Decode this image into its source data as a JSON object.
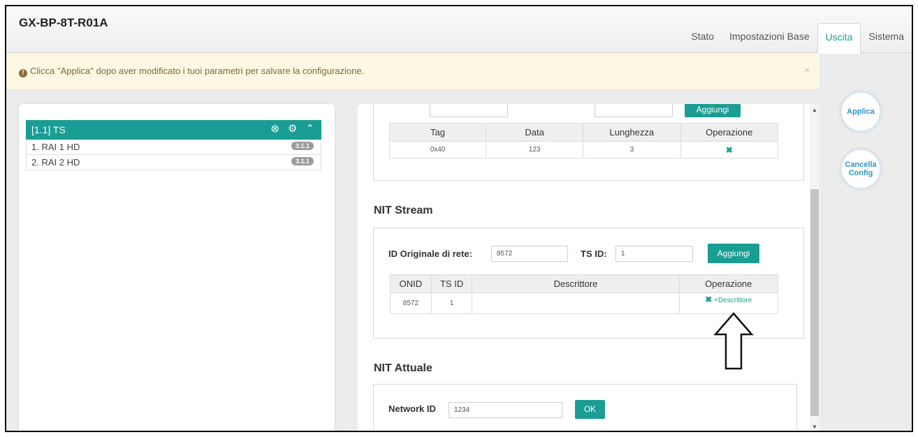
{
  "app": {
    "title": "GX-BP-8T-R01A"
  },
  "nav": [
    {
      "label": "Stato",
      "active": false
    },
    {
      "label": "Impostazioni Base",
      "active": false
    },
    {
      "label": "Uscita",
      "active": true
    },
    {
      "label": "Sistema",
      "active": false
    }
  ],
  "alert": {
    "icon": "info-icon",
    "text": "Clicca \"Applica\" dopo aver modificato i tuoi parametri per salvare la configurazione.",
    "close": "×"
  },
  "tree": {
    "head_label": "[1.1] TS",
    "items": [
      {
        "label": "1. RAI 1 HD",
        "badge": "3.1.1"
      },
      {
        "label": "2. RAI 2 HD",
        "badge": "3.1.1"
      }
    ]
  },
  "descriptor_table": {
    "headers": [
      "Tag",
      "Data",
      "Lunghezza",
      "Operazione"
    ],
    "rows": [
      {
        "tag": "0x40",
        "data": "123",
        "length": "3"
      }
    ],
    "add_label": "Aggiungi"
  },
  "nit_stream": {
    "title": "NIT Stream",
    "onid_label": "ID Originale di rete:",
    "onid_value": "8572",
    "tsid_label": "TS ID:",
    "tsid_value": "1",
    "add_label": "Aggiungi",
    "headers": [
      "ONID",
      "TS ID",
      "Descrittore",
      "Operazione"
    ],
    "rows": [
      {
        "onid": "8572",
        "tsid": "1",
        "descriptor": "",
        "add_desc": "+Descrittore"
      }
    ]
  },
  "nit_actual": {
    "title": "NIT Attuale",
    "network_label": "Network ID",
    "network_value": "1234",
    "ok_label": "OK"
  },
  "side_buttons": {
    "apply": "Applica",
    "cancel_line1": "Cancella",
    "cancel_line2": "Config"
  },
  "colors": {
    "accent": "#1a9d93",
    "alert_bg": "#fcf8e3",
    "side_text": "#2b94c8"
  }
}
